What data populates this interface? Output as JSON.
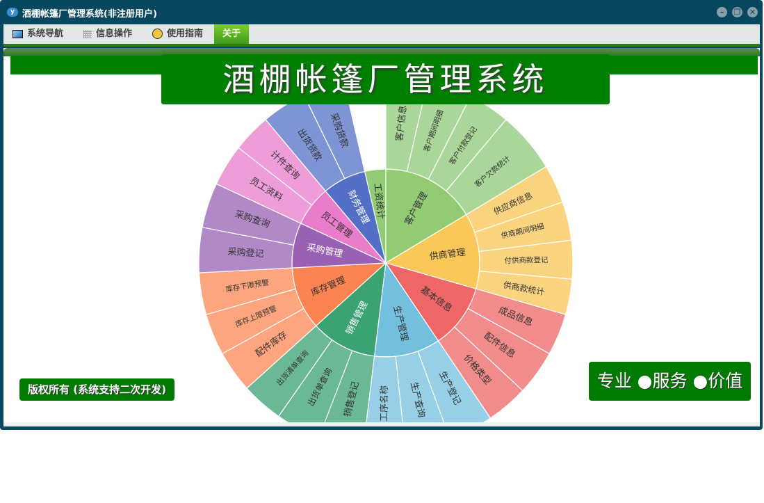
{
  "window": {
    "title": "酒棚帐篷厂管理系统(非注册用户)",
    "logo_text": "y",
    "controls": {
      "minimize": "–",
      "restore": "❐",
      "close": "✕"
    }
  },
  "menu": [
    {
      "label": "系统导航",
      "icon": "monitor-icon"
    },
    {
      "label": "信息操作",
      "icon": "grid-icon"
    },
    {
      "label": "使用指南",
      "icon": "help-icon"
    },
    {
      "label": "关于",
      "icon": null,
      "active": true
    }
  ],
  "banner": {
    "title": "酒棚帐篷厂管理系统"
  },
  "footer": {
    "copyright": "版权所有 (系统支持二次开发)",
    "slogan": "专业 ●服务 ●价值"
  },
  "colors": {
    "brand_green": "#008000",
    "window": "#07475f"
  },
  "chart_data": {
    "type": "sunburst",
    "start_angle_deg": -13,
    "direction": "clockwise",
    "series": [
      {
        "name": "工资统计",
        "value": 13,
        "color": "#91cb74",
        "label_color": "#333",
        "children": []
      },
      {
        "name": "客户管理",
        "value": 59,
        "color": "#91cb74",
        "child_color": "#abd699",
        "label_color": "#333",
        "children": [
          {
            "name": "客户信息",
            "value": 13
          },
          {
            "name": "客户期间明细",
            "value": 14
          },
          {
            "name": "客户付款登记",
            "value": 13
          },
          {
            "name": "客户欠款统计",
            "value": 19
          }
        ]
      },
      {
        "name": "供商管理",
        "value": 47,
        "color": "#fac858",
        "child_color": "#fbd480",
        "label_color": "#333",
        "children": [
          {
            "name": "供应商信息",
            "value": 12
          },
          {
            "name": "供商期间明细",
            "value": 12
          },
          {
            "name": "付供商款登记",
            "value": 12
          },
          {
            "name": "供商款统计",
            "value": 11
          }
        ]
      },
      {
        "name": "基本信息",
        "value": 40,
        "color": "#ee6666",
        "child_color": "#f28b8b",
        "label_color": "#333",
        "children": [
          {
            "name": "成品信息",
            "value": 13
          },
          {
            "name": "配件信息",
            "value": 14
          },
          {
            "name": "价格类型",
            "value": 13
          }
        ]
      },
      {
        "name": "生产管理",
        "value": 41,
        "color": "#73c0de",
        "child_color": "#96cfe6",
        "label_color": "#333",
        "children": [
          {
            "name": "生产登记",
            "value": 14
          },
          {
            "name": "生产查询",
            "value": 14
          },
          {
            "name": "工序名称",
            "value": 13
          }
        ]
      },
      {
        "name": "销售管理",
        "value": 41,
        "color": "#3ba272",
        "child_color": "#6ab994",
        "label_color": "#fff",
        "children": [
          {
            "name": "销售登记",
            "value": 14
          },
          {
            "name": "出货单查询",
            "value": 14
          },
          {
            "name": "出货清单查询",
            "value": 13
          }
        ]
      },
      {
        "name": "库存管理",
        "value": 39,
        "color": "#fc8452",
        "child_color": "#fda57f",
        "label_color": "#333",
        "children": [
          {
            "name": "配件库存",
            "value": 13
          },
          {
            "name": "库存上限预警",
            "value": 13
          },
          {
            "name": "库存下限预警",
            "value": 13
          }
        ]
      },
      {
        "name": "采购管理",
        "value": 28,
        "color": "#9a60b4",
        "child_color": "#b189c6",
        "label_color": "#fff",
        "children": [
          {
            "name": "采购登记",
            "value": 14
          },
          {
            "name": "采购查询",
            "value": 14
          }
        ]
      },
      {
        "name": "员工管理",
        "value": 25,
        "color": "#ea7ccc",
        "child_color": "#ef9dd8",
        "label_color": "#333",
        "children": [
          {
            "name": "员工资料",
            "value": 13
          },
          {
            "name": "计件查询",
            "value": 12
          }
        ]
      },
      {
        "name": "财务管理",
        "value": 27,
        "color": "#5470c6",
        "child_color": "#7f94d4",
        "label_color": "#fff",
        "children": [
          {
            "name": "出货货款",
            "value": 14
          },
          {
            "name": "采购货款",
            "value": 13
          }
        ]
      }
    ]
  }
}
